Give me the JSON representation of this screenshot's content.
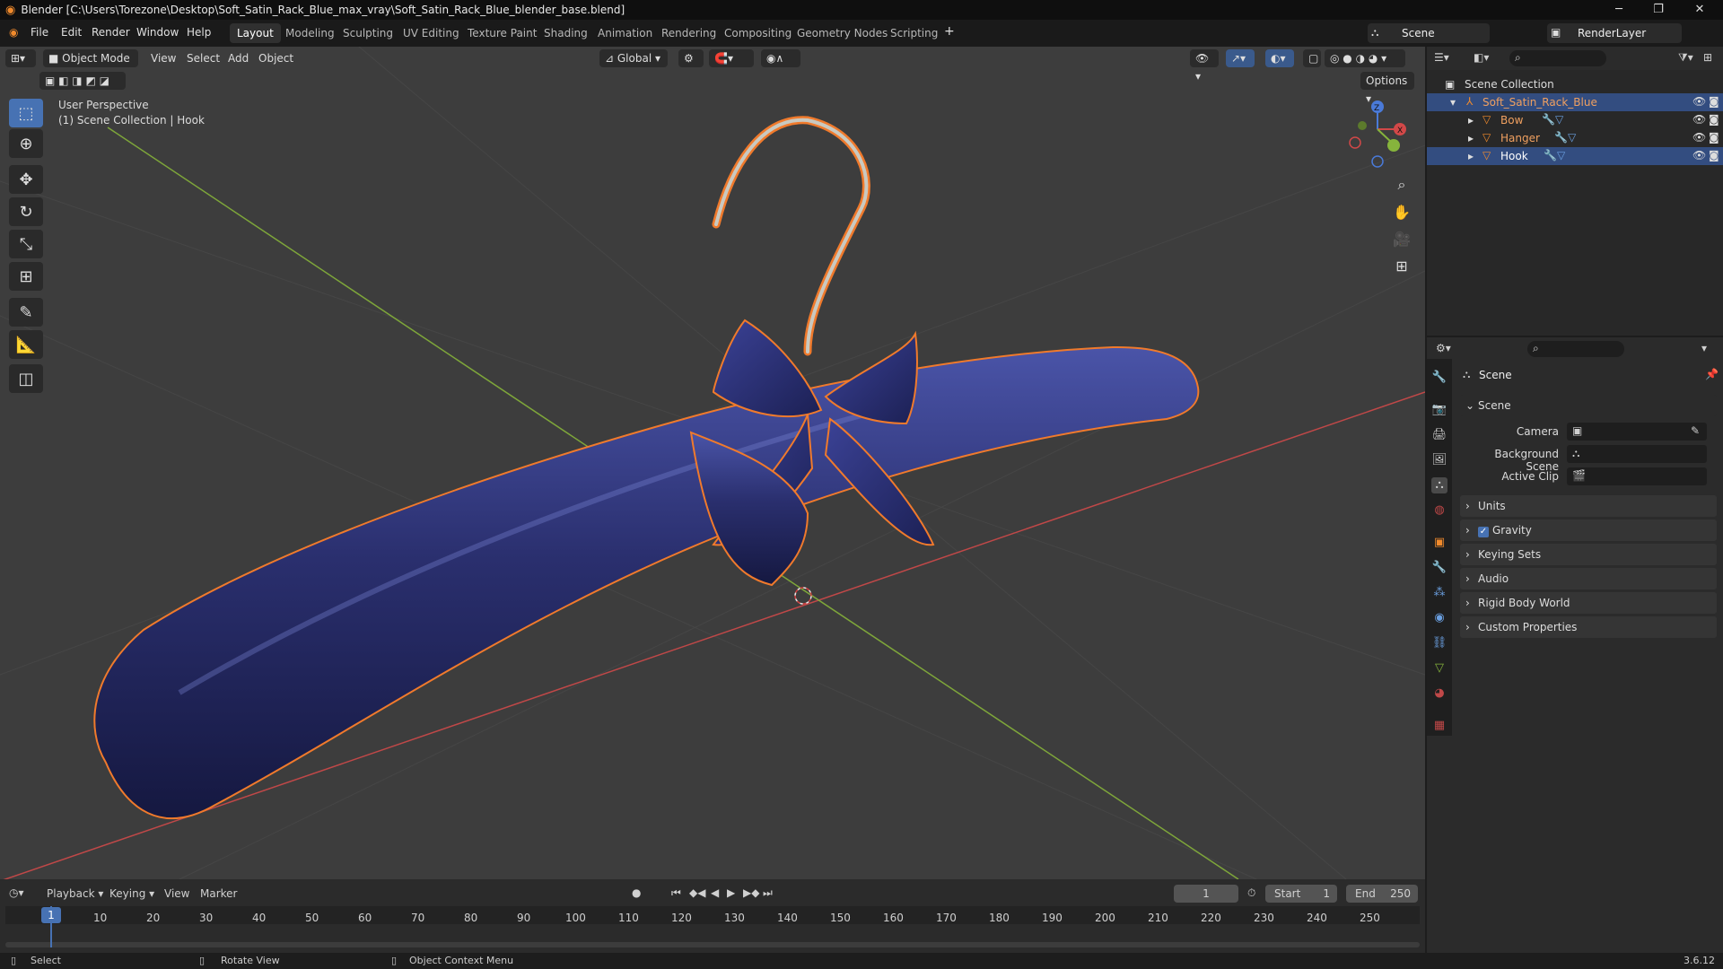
{
  "window": {
    "title": "Blender [C:\\Users\\Torezone\\Desktop\\Soft_Satin_Rack_Blue_max_vray\\Soft_Satin_Rack_Blue_blender_base.blend]"
  },
  "menus": [
    "File",
    "Edit",
    "Render",
    "Window",
    "Help"
  ],
  "workspaces": [
    "Layout",
    "Modeling",
    "Sculpting",
    "UV Editing",
    "Texture Paint",
    "Shading",
    "Animation",
    "Rendering",
    "Compositing",
    "Geometry Nodes",
    "Scripting"
  ],
  "active_workspace": "Layout",
  "scene_name": "Scene",
  "render_layer": "RenderLayer",
  "viewport": {
    "mode": "Object Mode",
    "menu_view": "View",
    "menu_select": "Select",
    "menu_add": "Add",
    "menu_object": "Object",
    "transform_orientation": "Global",
    "options_label": "Options",
    "perspective_label": "User Perspective",
    "collection_label": "(1) Scene Collection | Hook"
  },
  "outliner": {
    "root": "Scene Collection",
    "items": [
      {
        "name": "Soft_Satin_Rack_Blue",
        "selected": true
      },
      {
        "name": "Bow",
        "selected": false
      },
      {
        "name": "Hanger",
        "selected": false
      },
      {
        "name": "Hook",
        "selected": true
      }
    ]
  },
  "properties": {
    "header": "Scene",
    "section": "Scene",
    "camera_label": "Camera",
    "background_scene_label": "Background Scene",
    "active_clip_label": "Active Clip",
    "panels": [
      "Units",
      "Gravity",
      "Keying Sets",
      "Audio",
      "Rigid Body World",
      "Custom Properties"
    ],
    "gravity_checked": true
  },
  "timeline": {
    "menus": [
      "Playback",
      "Keying",
      "View",
      "Marker"
    ],
    "current_frame": "1",
    "start_label": "Start",
    "start_value": "1",
    "end_label": "End",
    "end_value": "250",
    "ruler": [
      "1",
      "10",
      "20",
      "30",
      "40",
      "50",
      "60",
      "70",
      "80",
      "90",
      "100",
      "110",
      "120",
      "130",
      "140",
      "150",
      "160",
      "170",
      "180",
      "190",
      "200",
      "210",
      "220",
      "230",
      "240",
      "250"
    ]
  },
  "statusbar": {
    "select": "Select",
    "rotate": "Rotate View",
    "context": "Object Context Menu",
    "version": "3.6.12"
  },
  "colors": {
    "accent_blue": "#4772b3",
    "selection_orange": "#f07a2c",
    "satin_blue": "#2a2f6e",
    "x_axis": "#d24848",
    "y_axis": "#86b43c"
  }
}
